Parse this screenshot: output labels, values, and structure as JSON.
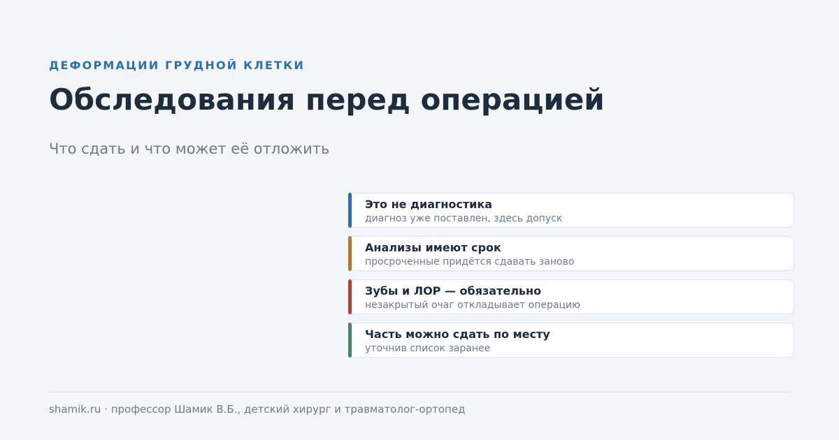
{
  "header": {
    "eyebrow": "ДЕФОРМАЦИИ ГРУДНОЙ КЛЕТКИ",
    "title": "Обследования перед операцией",
    "subtitle": "Что сдать и что может её отложить"
  },
  "cards": [
    {
      "title": "Это не диагностика",
      "subtitle": "диагноз уже поставлен, здесь допуск",
      "accent": "#2f6ea7"
    },
    {
      "title": "Анализы имеют срок",
      "subtitle": "просроченные придётся сдавать заново",
      "accent": "#b57a2c"
    },
    {
      "title": "Зубы и ЛОР — обязательно",
      "subtitle": "незакрытый очаг откладывает операцию",
      "accent": "#b2433c"
    },
    {
      "title": "Часть можно сдать по месту",
      "subtitle": "уточнив список заранее",
      "accent": "#4a8466"
    }
  ],
  "footer": {
    "text": "shamik.ru · профессор Шамик В.Б., детский хирург и травматолог-ортопед"
  }
}
